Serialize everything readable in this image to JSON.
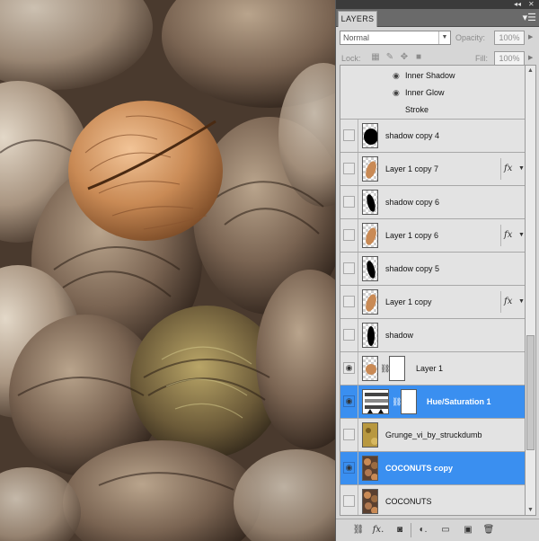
{
  "panel": {
    "tab_label": "LAYERS",
    "blend_mode": "Normal",
    "opacity_label": "Opacity:",
    "opacity_value": "100%",
    "lock_label": "Lock:",
    "fill_label": "Fill:",
    "fill_value": "100%"
  },
  "effects": [
    {
      "name": "Inner Shadow",
      "visible": true
    },
    {
      "name": "Inner Glow",
      "visible": true
    },
    {
      "name": "Stroke",
      "visible": false
    }
  ],
  "layers": [
    {
      "name": "shadow copy 4",
      "thumb": "black-blob",
      "visible": false,
      "fx": false,
      "mask": false,
      "selected": false
    },
    {
      "name": "Layer 1 copy 7",
      "thumb": "coconut",
      "visible": false,
      "fx": true,
      "mask": false,
      "selected": false
    },
    {
      "name": "shadow copy 6",
      "thumb": "black-oval",
      "visible": false,
      "fx": false,
      "mask": false,
      "selected": false
    },
    {
      "name": "Layer 1 copy 6",
      "thumb": "coconut",
      "visible": false,
      "fx": true,
      "mask": false,
      "selected": false
    },
    {
      "name": "shadow copy 5",
      "thumb": "black-oval",
      "visible": false,
      "fx": false,
      "mask": false,
      "selected": false
    },
    {
      "name": "Layer 1 copy",
      "thumb": "coconut",
      "visible": false,
      "fx": true,
      "mask": false,
      "selected": false
    },
    {
      "name": "shadow",
      "thumb": "black-oval",
      "visible": false,
      "fx": false,
      "mask": false,
      "selected": false
    },
    {
      "name": "Layer 1",
      "thumb": "coconut",
      "visible": true,
      "fx": false,
      "mask": true,
      "selected": false
    },
    {
      "name": "Hue/Saturation 1",
      "thumb": "adjustment",
      "visible": true,
      "fx": false,
      "mask": true,
      "selected": true
    },
    {
      "name": "Grunge_vi_by_struckdumb",
      "thumb": "grunge",
      "visible": false,
      "fx": false,
      "mask": false,
      "selected": false
    },
    {
      "name": "COCONUTS copy",
      "thumb": "coconuts-photo",
      "visible": true,
      "fx": false,
      "mask": false,
      "selected": true
    },
    {
      "name": "COCONUTS",
      "thumb": "coconuts-photo",
      "visible": false,
      "fx": false,
      "mask": false,
      "selected": false
    }
  ],
  "colors": {
    "selection": "#3a8ff0",
    "panel_bg": "#d6d6d6",
    "coconut": "#c98a55"
  },
  "icons": {
    "visibility": "eye-icon",
    "mask_link": "chain-icon",
    "fx": "fx-icon",
    "bottom_bar": [
      "link-layers-icon",
      "add-style-icon",
      "add-mask-icon",
      "adjustment-layer-icon",
      "group-icon",
      "new-layer-icon",
      "trash-icon"
    ]
  }
}
